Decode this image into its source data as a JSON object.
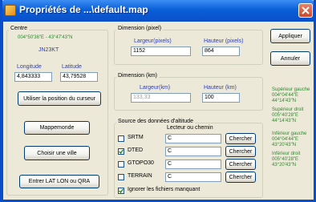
{
  "window": {
    "title": "Propriétés de ...\\default.map"
  },
  "centre": {
    "label": "Centre",
    "coords": "004°50'36\"E - 43°47'43\"N",
    "locator": "JN23KT",
    "longitude_label": "Longitude",
    "latitude_label": "Latitude",
    "longitude_value": "4,843333",
    "latitude_value": "43,79528",
    "use_cursor_button": "Utiliser la position du curseur",
    "world_button": "Mappemonde",
    "choose_city_button": "Choisir une ville",
    "enter_lat_lon_button": "Entrer LAT LON ou QRA"
  },
  "dim_pixel": {
    "label": "Dimension (pixel)",
    "width_label": "Largeur(pixels)",
    "height_label": "Hauteur (pixels)",
    "width_value": "1152",
    "height_value": "864"
  },
  "dim_km": {
    "label": "Dimension (km)",
    "width_label": "Largeur(km)",
    "height_label": "Hauteur (km)",
    "width_value": "133,33",
    "height_value": "100"
  },
  "source": {
    "label": "Source des données d'altitude",
    "column_label": "Lecteur ou chemin",
    "rows": [
      {
        "name": "SRTM",
        "path": "C",
        "checked": false,
        "button": "Chercher"
      },
      {
        "name": "DTED",
        "path": "C",
        "checked": true,
        "button": "Chercher"
      },
      {
        "name": "GTOPO30",
        "path": "C",
        "checked": false,
        "button": "Chercher"
      },
      {
        "name": "TERRAIN",
        "path": "C",
        "checked": false,
        "button": "Chercher"
      }
    ],
    "ignore_label": "Ignorer les fichiers manquant",
    "ignore_checked": true
  },
  "buttons": {
    "apply": "Appliquer",
    "cancel": "Annuler"
  },
  "corners": {
    "top_left_label": "Supérieur gauche",
    "top_left_lon": "004°04'44\"E",
    "top_left_lat": "44°14'43\"N",
    "top_right_label": "Supérieur droit",
    "top_right_lon": "005°40'28\"E",
    "top_right_lat": "44°14'43\"N",
    "bottom_left_label": "Inférieur gauche",
    "bottom_left_lon": "004°04'44\"E",
    "bottom_left_lat": "43°20'43\"N",
    "bottom_right_label": "Inférieur droit",
    "bottom_right_lon": "005°40'28\"E",
    "bottom_right_lat": "43°20'43\"N"
  },
  "colors": {
    "accent_blue": "#2b3fbf",
    "accent_green": "#2e8a2e",
    "titlebar": "#0a5fd8"
  }
}
